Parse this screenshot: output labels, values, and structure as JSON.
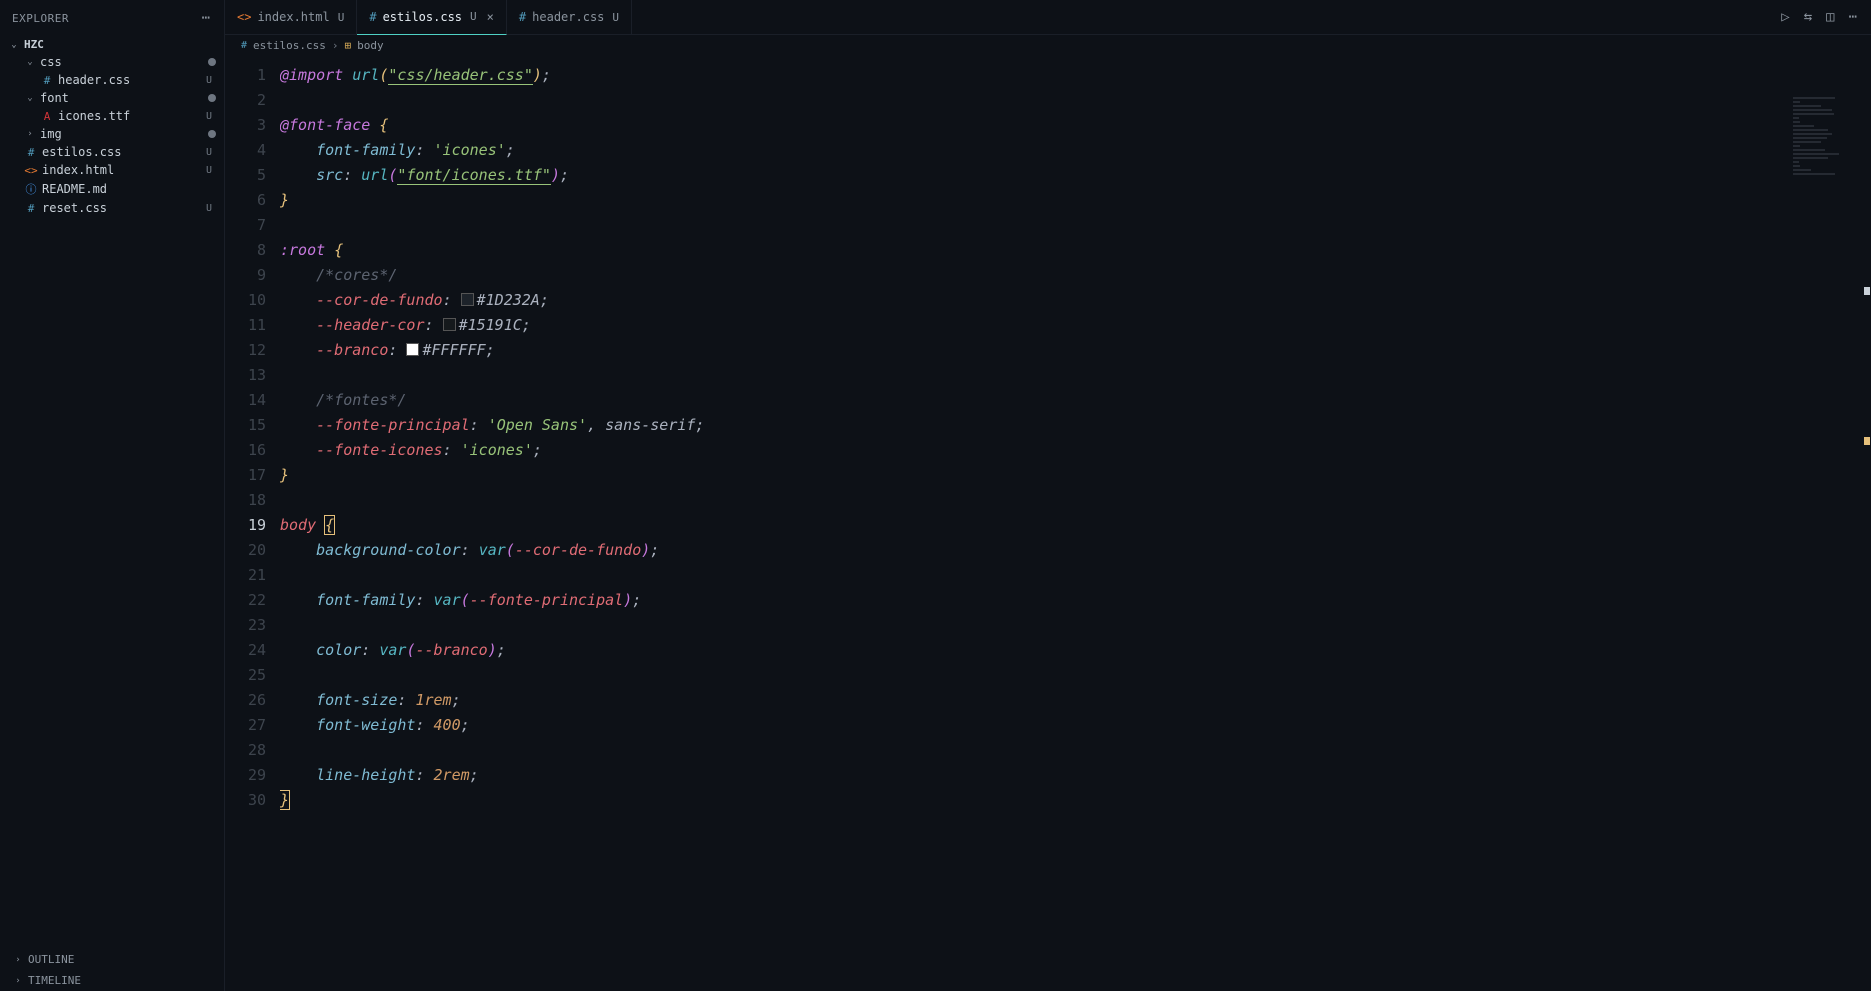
{
  "explorer": {
    "title": "EXPLORER",
    "root": "HZC",
    "outline": "OUTLINE",
    "timeline": "TIMELINE",
    "items": [
      {
        "name": "css",
        "type": "folder",
        "expanded": true,
        "indent": 1,
        "status": "dot"
      },
      {
        "name": "header.css",
        "type": "css",
        "indent": 2,
        "status": "U"
      },
      {
        "name": "font",
        "type": "folder",
        "expanded": true,
        "indent": 1,
        "status": "dot"
      },
      {
        "name": "icones.ttf",
        "type": "font",
        "indent": 2,
        "status": "U"
      },
      {
        "name": "img",
        "type": "folder",
        "expanded": false,
        "indent": 1,
        "status": "dot"
      },
      {
        "name": "estilos.css",
        "type": "css",
        "indent": 1,
        "status": "U"
      },
      {
        "name": "index.html",
        "type": "html",
        "indent": 1,
        "status": "U"
      },
      {
        "name": "README.md",
        "type": "md",
        "indent": 1,
        "status": ""
      },
      {
        "name": "reset.css",
        "type": "css",
        "indent": 1,
        "status": "U"
      }
    ]
  },
  "tabs": {
    "list": [
      {
        "icon": "html",
        "label": "index.html",
        "status": "U",
        "active": false
      },
      {
        "icon": "css",
        "label": "estilos.css",
        "status": "U",
        "active": true,
        "close": true
      },
      {
        "icon": "css",
        "label": "header.css",
        "status": "U",
        "active": false
      }
    ]
  },
  "breadcrumb": {
    "file": "estilos.css",
    "symbol": "body"
  },
  "code": {
    "lines": [
      {
        "n": 1,
        "html": "<span class='tok-at'>@import</span> <span class='tok-fn'>url</span><span class='tok-br'>(</span><span class='tok-str-u'>\"css/header.css\"</span><span class='tok-br'>)</span><span class='tok-white'>;</span>"
      },
      {
        "n": 2,
        "html": ""
      },
      {
        "n": 3,
        "html": "<span class='tok-at'>@font-face</span> <span class='tok-br'>{</span>"
      },
      {
        "n": 4,
        "html": "    <span class='tok-prop'>font-family</span><span class='tok-white'>:</span> <span class='tok-str'>'icones'</span><span class='tok-white'>;</span>"
      },
      {
        "n": 5,
        "html": "    <span class='tok-prop'>src</span><span class='tok-white'>:</span> <span class='tok-fn'>url</span><span class='tok-br2'>(</span><span class='tok-str-u'>\"font/icones.ttf\"</span><span class='tok-br2'>)</span><span class='tok-white'>;</span>"
      },
      {
        "n": 6,
        "html": "<span class='tok-br'>}</span>"
      },
      {
        "n": 7,
        "html": ""
      },
      {
        "n": 8,
        "html": "<span class='tok-pseudo'>:root</span> <span class='tok-br'>{</span>"
      },
      {
        "n": 9,
        "html": "    <span class='tok-com'>/*cores*/</span>"
      },
      {
        "n": 10,
        "html": "    <span class='tok-var'>--cor-de-fundo</span><span class='tok-white'>:</span> <span class='color-swatch' style='background:#1D232A'></span><span class='tok-white'>#1D232A;</span>"
      },
      {
        "n": 11,
        "html": "    <span class='tok-var'>--header-cor</span><span class='tok-white'>:</span> <span class='color-swatch' style='background:#15191C'></span><span class='tok-white'>#15191C;</span>"
      },
      {
        "n": 12,
        "html": "    <span class='tok-var'>--branco</span><span class='tok-white'>:</span> <span class='color-swatch' style='background:#FFFFFF'></span><span class='tok-white'>#FFFFFF;</span>"
      },
      {
        "n": 13,
        "html": ""
      },
      {
        "n": 14,
        "html": "    <span class='tok-com'>/*fontes*/</span>"
      },
      {
        "n": 15,
        "html": "    <span class='tok-var'>--fonte-principal</span><span class='tok-white'>:</span> <span class='tok-str'>'Open Sans'</span><span class='tok-white'>,</span> <span class='tok-white'>sans-serif;</span>"
      },
      {
        "n": 16,
        "html": "    <span class='tok-var'>--fonte-icones</span><span class='tok-white'>:</span> <span class='tok-str'>'icones'</span><span class='tok-white'>;</span>"
      },
      {
        "n": 17,
        "html": "<span class='tok-br'>}</span>"
      },
      {
        "n": 18,
        "html": ""
      },
      {
        "n": 19,
        "html": "<span class='tok-sel'>body</span> <span class='tok-br bracket-hl'>{</span>",
        "active": true
      },
      {
        "n": 20,
        "html": "    <span class='tok-prop'>background-color</span><span class='tok-white'>:</span> <span class='tok-fn'>var</span><span class='tok-br2'>(</span><span class='tok-var'>--cor-de-fundo</span><span class='tok-br2'>)</span><span class='tok-white'>;</span>"
      },
      {
        "n": 21,
        "html": ""
      },
      {
        "n": 22,
        "html": "    <span class='tok-prop'>font-family</span><span class='tok-white'>:</span> <span class='tok-fn'>var</span><span class='tok-br2'>(</span><span class='tok-var'>--fonte-principal</span><span class='tok-br2'>)</span><span class='tok-white'>;</span>"
      },
      {
        "n": 23,
        "html": ""
      },
      {
        "n": 24,
        "html": "    <span class='tok-prop'>color</span><span class='tok-white'>:</span> <span class='tok-fn'>var</span><span class='tok-br2'>(</span><span class='tok-var'>--branco</span><span class='tok-br2'>)</span><span class='tok-white'>;</span>"
      },
      {
        "n": 25,
        "html": ""
      },
      {
        "n": 26,
        "html": "    <span class='tok-prop'>font-size</span><span class='tok-white'>:</span> <span class='tok-num'>1rem</span><span class='tok-white'>;</span>"
      },
      {
        "n": 27,
        "html": "    <span class='tok-prop'>font-weight</span><span class='tok-white'>:</span> <span class='tok-num'>400</span><span class='tok-white'>;</span>"
      },
      {
        "n": 28,
        "html": ""
      },
      {
        "n": 29,
        "html": "    <span class='tok-prop'>line-height</span><span class='tok-white'>:</span> <span class='tok-num'>2rem</span><span class='tok-white'>;</span>"
      },
      {
        "n": 30,
        "html": "<span class='tok-br bracket-hl'>}</span>"
      }
    ]
  }
}
